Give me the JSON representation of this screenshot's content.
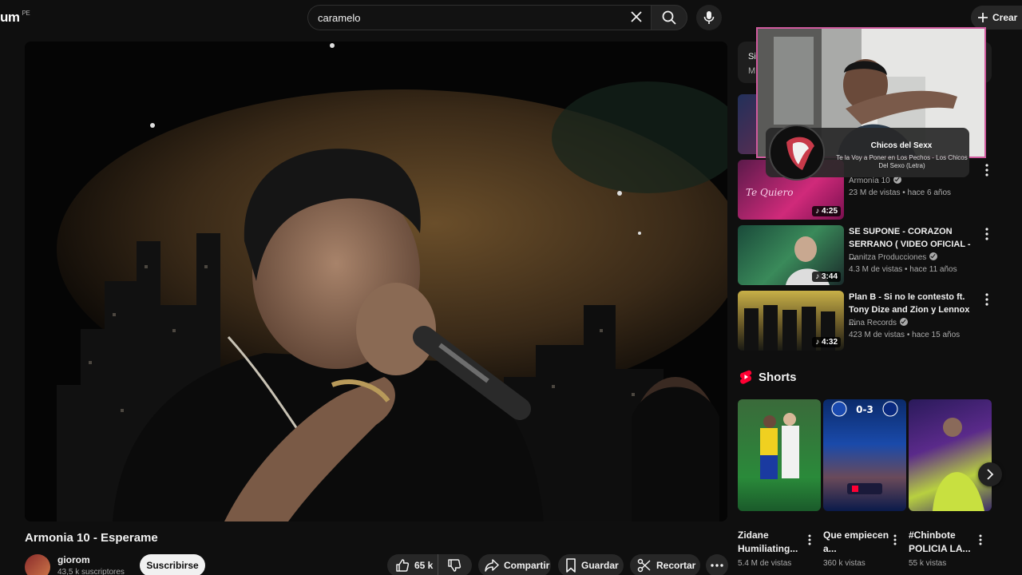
{
  "header": {
    "logo_text": "um",
    "region": "PE",
    "search_value": "caramelo",
    "create_label": "Crear"
  },
  "video": {
    "title": "Armonia 10 - Esperame",
    "channel": "giorom",
    "subscribers": "43,5 k suscriptores",
    "subscribe_label": "Suscribirse",
    "likes": "65 k",
    "share_label": "Compartir",
    "save_label": "Guardar",
    "clip_label": "Recortar"
  },
  "sidebar": {
    "chip_text_top": "Si",
    "chip_text_bottom": "M",
    "recommended": [
      {
        "title": "",
        "channel": "Armonía 10",
        "meta": "23 M de vistas • hace 6 años",
        "duration": "4:25"
      },
      {
        "title": "SE SUPONE - CORAZON SERRANO ( VIDEO OFICIAL - ...",
        "channel": "Danitza Producciones",
        "meta": "4.3 M de vistas • hace 11 años",
        "duration": "3:44"
      },
      {
        "title": "Plan B - Si no le contesto ft. Tony Dize and Zion y Lennox ...",
        "channel": "Pina Records",
        "meta": "423 M de vistas • hace 15 años",
        "duration": "4:32"
      }
    ],
    "shorts_title": "Shorts",
    "shorts": [
      {
        "title": "Zidane Humiliating...",
        "views": "5.4 M de vistas"
      },
      {
        "title": "Que empiecen a...",
        "views": "360 k vistas"
      },
      {
        "title": "#Chinbote POLICIA LA...",
        "views": "55 k vistas"
      }
    ]
  },
  "overlay": {
    "now_playing_artist": "Chicos del Sexx",
    "now_playing_song": "Te la Voy a Poner en Los Pechos - Los Chicos Del Sexo (Letra)"
  },
  "colors": {
    "background": "#0f0f0f",
    "accent": "#ff0033",
    "cam_border": "#d05a9e"
  }
}
